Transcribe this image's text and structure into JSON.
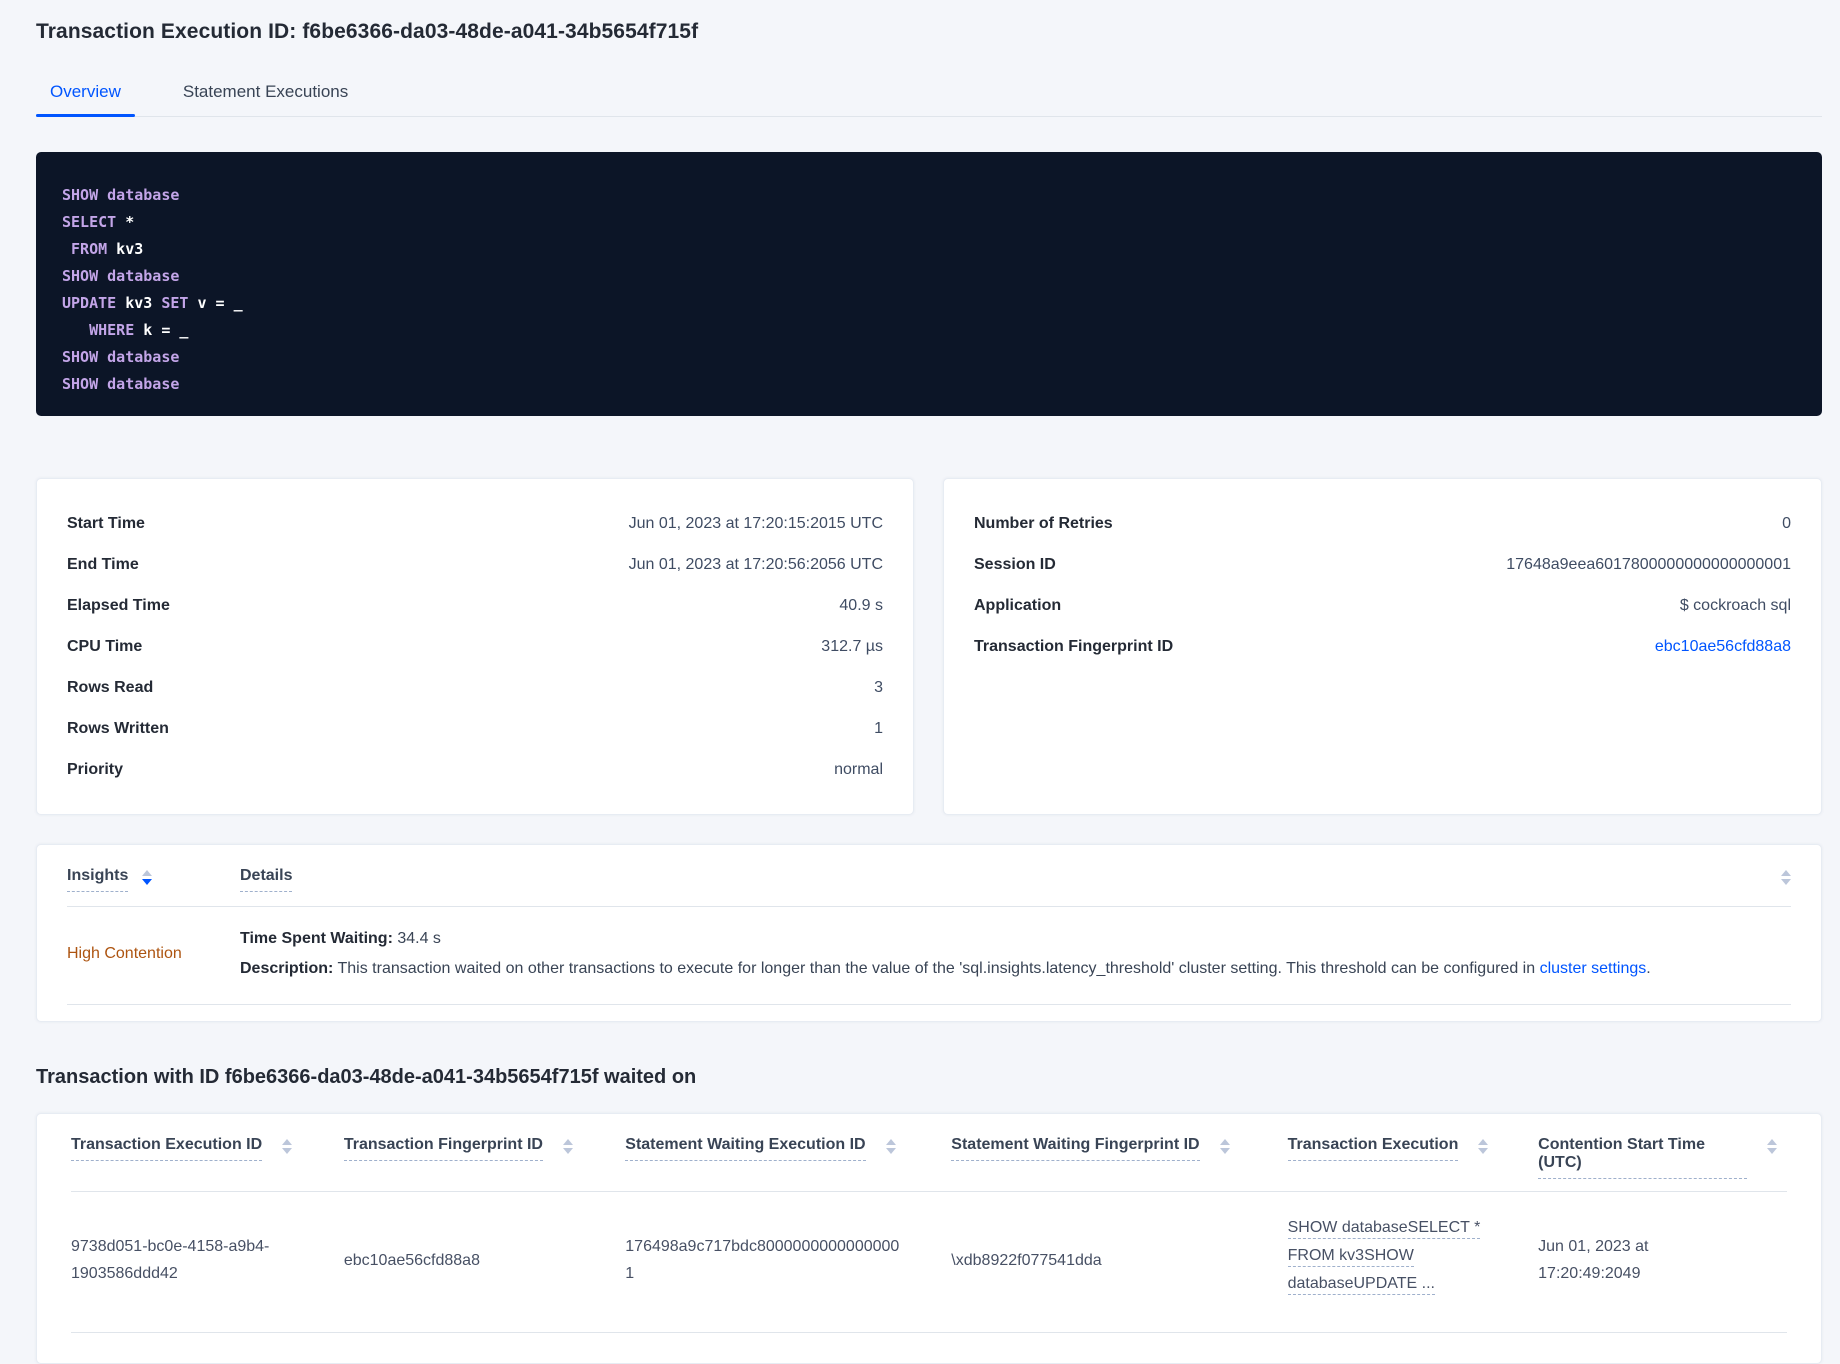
{
  "header": {
    "title": "Transaction Execution ID: f6be6366-da03-48de-a041-34b5654f715f",
    "tabs": [
      {
        "label": "Overview"
      },
      {
        "label": "Statement Executions"
      }
    ]
  },
  "accent_colors": {
    "link_blue": "#0055ff",
    "insight_orange": "#ad5410",
    "sql_keyword_purple": "#c3a5e8",
    "sql_box_background": "#0c1527"
  },
  "sql": {
    "lines": [
      {
        "segments": [
          {
            "text": "SHOW database",
            "style": "keyword"
          }
        ]
      },
      {
        "segments": [
          {
            "text": "SELECT",
            "style": "keyword"
          },
          {
            "text": " *",
            "style": "plain"
          }
        ]
      },
      {
        "segments": [
          {
            "text": " FROM",
            "style": "keyword"
          },
          {
            "text": " kv3",
            "style": "plain"
          }
        ]
      },
      {
        "segments": [
          {
            "text": "SHOW database",
            "style": "keyword"
          }
        ]
      },
      {
        "segments": [
          {
            "text": "UPDATE",
            "style": "keyword"
          },
          {
            "text": " kv3 ",
            "style": "plain"
          },
          {
            "text": "SET",
            "style": "keyword"
          },
          {
            "text": " v = _",
            "style": "plain"
          }
        ]
      },
      {
        "segments": [
          {
            "text": "   WHERE",
            "style": "keyword"
          },
          {
            "text": " k = _",
            "style": "plain"
          }
        ]
      },
      {
        "segments": [
          {
            "text": "SHOW database",
            "style": "keyword"
          }
        ]
      },
      {
        "segments": [
          {
            "text": "SHOW database",
            "style": "keyword"
          }
        ]
      }
    ]
  },
  "details_card": {
    "rows": [
      {
        "label": "Start Time",
        "value": "Jun 01, 2023 at 17:20:15:2015 UTC"
      },
      {
        "label": "End Time",
        "value": "Jun 01, 2023 at 17:20:56:2056 UTC"
      },
      {
        "label": "Elapsed Time",
        "value": "40.9 s"
      },
      {
        "label": "CPU Time",
        "value": "312.7 µs"
      },
      {
        "label": "Rows Read",
        "value": "3"
      },
      {
        "label": "Rows Written",
        "value": "1"
      },
      {
        "label": "Priority",
        "value": "normal"
      }
    ]
  },
  "meta_card": {
    "rows": [
      {
        "label": "Number of Retries",
        "value": "0"
      },
      {
        "label": "Session ID",
        "value": "17648a9eea6017800000000000000001"
      },
      {
        "label": "Application",
        "value": "$ cockroach sql"
      },
      {
        "label": "Transaction Fingerprint ID",
        "value": "ebc10ae56cfd88a8"
      }
    ]
  },
  "insights_table": {
    "col1_header": "Insights",
    "col2_header": "Details",
    "row": {
      "insight": "High Contention",
      "waiting_label": "Time Spent Waiting:",
      "waiting_value": " 34.4 s",
      "description_label": "Description:",
      "description_text": " This transaction waited on other transactions to execute for longer than the value of the 'sql.insights.latency_threshold' cluster setting. This threshold can be configured in ",
      "description_link": "cluster settings",
      "description_suffix": "."
    }
  },
  "waited_on": {
    "heading": "Transaction with ID f6be6366-da03-48de-a041-34b5654f715f waited on",
    "columns": [
      "Transaction Execution ID",
      "Transaction Fingerprint ID",
      "Statement Waiting Execution ID",
      "Statement Waiting Fingerprint ID",
      "Transaction Execution",
      "Contention Start Time (UTC)"
    ],
    "row": {
      "transaction_execution_id": "9738d051-bc0e-4158-a9b4-1903586ddd42",
      "transaction_fingerprint_id": "ebc10ae56cfd88a8",
      "statement_waiting_execution_id": "176498a9c717bdc80000000000000001",
      "statement_waiting_fingerprint_id": "\\xdb8922f077541dda",
      "transaction_execution_lines": [
        "SHOW databaseSELECT *",
        "FROM kv3SHOW",
        "databaseUPDATE ..."
      ],
      "contention_start_time": "Jun 01, 2023 at 17:20:49:2049"
    }
  }
}
